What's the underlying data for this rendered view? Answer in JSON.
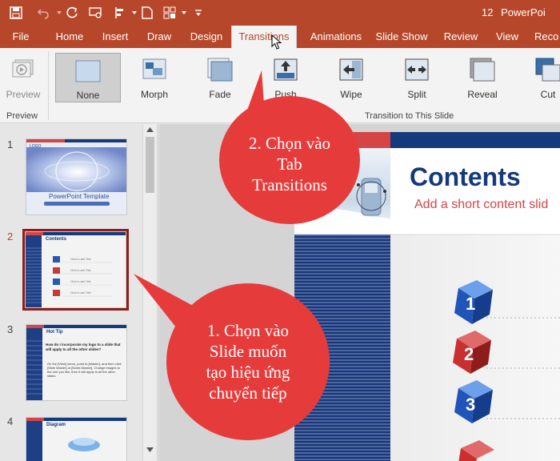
{
  "titlebar": {
    "slide_count": "12",
    "app_name": "PowerPoi"
  },
  "tabs": [
    {
      "label": "File"
    },
    {
      "label": "Home"
    },
    {
      "label": "Insert"
    },
    {
      "label": "Draw"
    },
    {
      "label": "Design"
    },
    {
      "label": "Transitions"
    },
    {
      "label": "Animations"
    },
    {
      "label": "Slide Show"
    },
    {
      "label": "Review"
    },
    {
      "label": "View"
    },
    {
      "label": "Reco"
    }
  ],
  "ribbon": {
    "preview_label": "Preview",
    "preview_group": "Preview",
    "transitions_group": "Transition to This Slide",
    "effects": [
      {
        "label": "None"
      },
      {
        "label": "Morph"
      },
      {
        "label": "Fade"
      },
      {
        "label": "Push"
      },
      {
        "label": "Wipe"
      },
      {
        "label": "Split"
      },
      {
        "label": "Reveal"
      },
      {
        "label": "Cut"
      }
    ]
  },
  "thumbnails": [
    {
      "number": "1",
      "title": "PowerPoint Template",
      "logo": "LOGO"
    },
    {
      "number": "2",
      "title": "Contents",
      "rows": [
        "Click to add Title",
        "Click to add Title",
        "Click to add Title",
        "Click to add Title"
      ]
    },
    {
      "number": "3",
      "title": "Hot Tip",
      "body": "How do I incorporate my logo to a slide that will apply to all the other slides?",
      "body2": "On the [View] menu, point to [Master], and then click [Slide Master] or [Notes Master]. Change images to the one you like, then it will apply to all the other slides."
    },
    {
      "number": "4",
      "title": "Diagram"
    }
  ],
  "slide": {
    "title": "Contents",
    "subtitle": "Add a short content slid",
    "items": [
      "1",
      "2",
      "3"
    ]
  },
  "callouts": {
    "tab": [
      "2. Chọn vào",
      "Tab",
      "Transitions"
    ],
    "slide": [
      "1. Chọn vào",
      "Slide muốn",
      "tạo hiệu ứng",
      "chuyển tiếp"
    ]
  },
  "colors": {
    "accent": "#b7472a",
    "callout": "#e63b3b",
    "slide_blue": "#14397d"
  }
}
